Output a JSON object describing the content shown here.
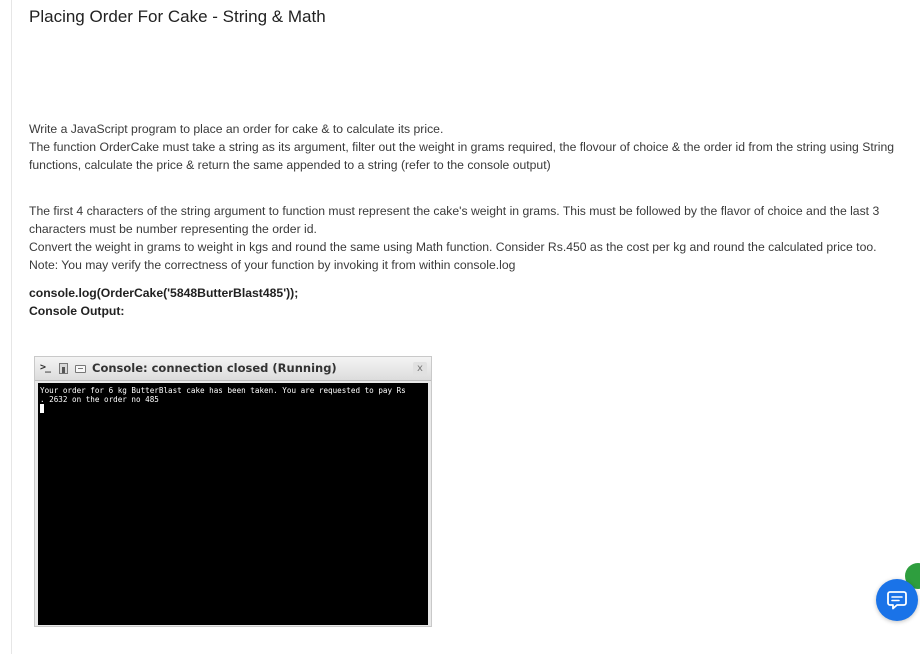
{
  "page": {
    "title": "Placing Order For Cake - String & Math"
  },
  "description": {
    "p1_line1": "Write a JavaScript program to place an order for cake & to calculate its price.",
    "p1_line2": "The function OrderCake must take a string as its argument, filter out the weight in grams required, the flovour of choice & the order id from the string using String functions, calculate the price & return the same appended to a string (refer to the console output)",
    "p2_line1": "The first 4 characters of the string argument to function must represent the cake's weight in grams. This must be followed by the flavor of choice and the last 3 characters must be number representing the order id.",
    "p2_line2": "Convert the weight in grams to weight in kgs and round the same using Math function. Consider Rs.450 as the cost per kg and round the calculated price too.",
    "p2_line3": "Note: You may verify the correctness of your function by invoking it from within console.log",
    "code_call": "console.log(OrderCake('5848ButterBlast485'));",
    "output_label": "Console Output:"
  },
  "console": {
    "title": "Console: connection closed (Running)",
    "close_glyph": "x",
    "prompt_glyph": ">_",
    "output_line1": "Your order for 6 kg ButterBlast cake has been taken. You are requested to pay Rs",
    "output_line2": ". 2632 on the order no 485"
  },
  "icons": {
    "chat": "chat-support-icon",
    "console_prompt": "terminal-prompt-icon",
    "copy": "document-icon",
    "console": "console-window-icon",
    "close": "close-icon"
  },
  "colors": {
    "fab": "#1a73e8",
    "badge": "#2e9e3e",
    "console_bg": "#000000"
  }
}
